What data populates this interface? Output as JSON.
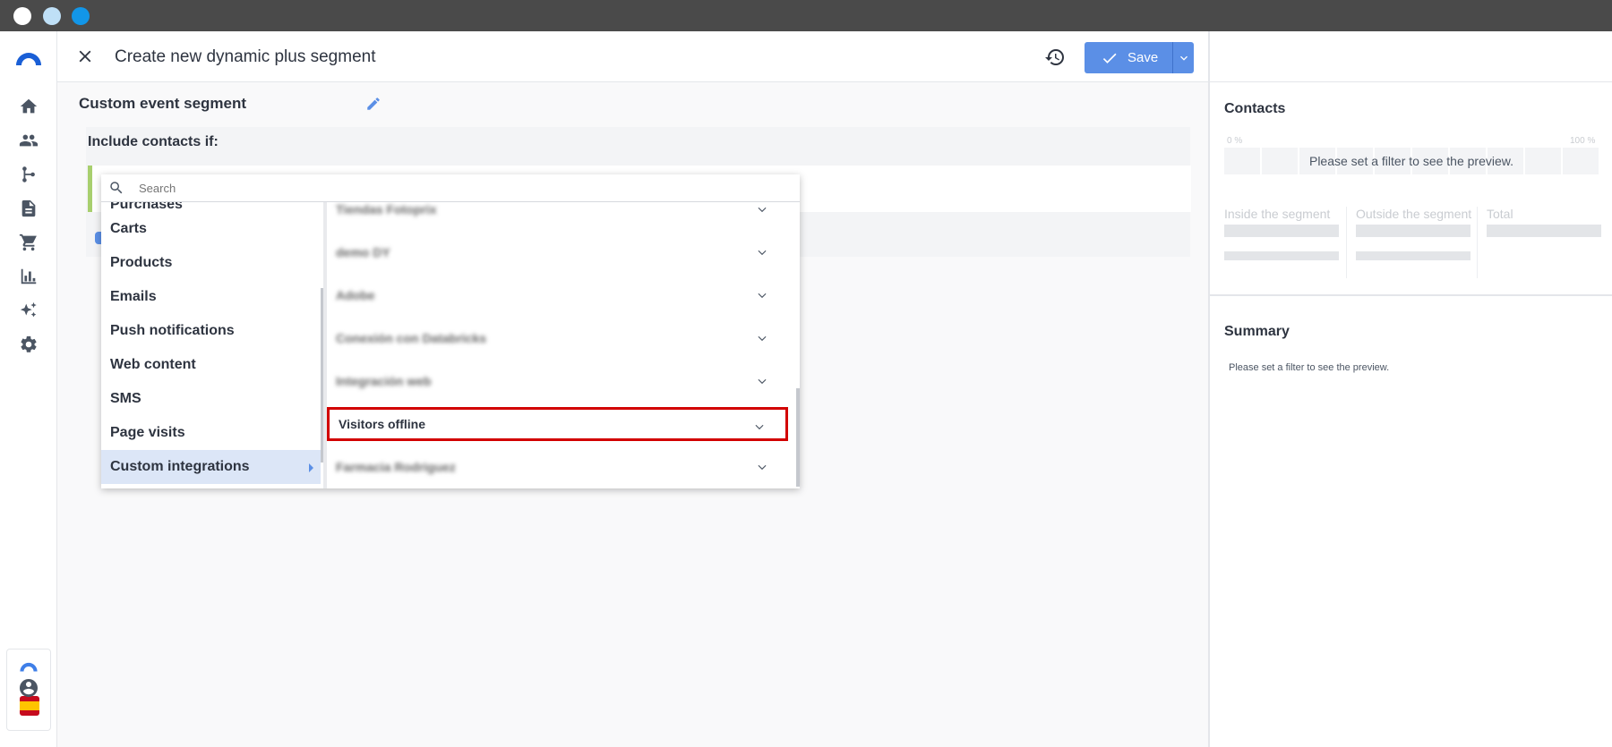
{
  "header": {
    "title": "Create new dynamic plus segment",
    "save_label": "Save"
  },
  "segment": {
    "name": "Custom event segment",
    "include_label": "Include contacts if:"
  },
  "dropdown": {
    "search_placeholder": "Search",
    "categories": [
      {
        "label": "Purchases",
        "active": false
      },
      {
        "label": "Carts",
        "active": false
      },
      {
        "label": "Products",
        "active": false
      },
      {
        "label": "Emails",
        "active": false
      },
      {
        "label": "Push notifications",
        "active": false
      },
      {
        "label": "Web content",
        "active": false
      },
      {
        "label": "SMS",
        "active": false
      },
      {
        "label": "Page visits",
        "active": false
      },
      {
        "label": "Custom integrations",
        "active": true
      }
    ],
    "integrations": [
      {
        "label": "Tiendas Fotoprix",
        "blurred": true,
        "highlighted": false
      },
      {
        "label": "demo DY",
        "blurred": true,
        "highlighted": false
      },
      {
        "label": "Adobe",
        "blurred": true,
        "highlighted": false
      },
      {
        "label": "Conexión con Databricks",
        "blurred": true,
        "highlighted": false
      },
      {
        "label": "Integración web",
        "blurred": true,
        "highlighted": false
      },
      {
        "label": "Visitors offline",
        "blurred": false,
        "highlighted": true
      },
      {
        "label": "Farmacia Rodriguez",
        "blurred": true,
        "highlighted": false
      }
    ]
  },
  "preview": {
    "contacts_title": "Contacts",
    "pct_min": "0 %",
    "pct_max": "100 %",
    "empty_message": "Please set a filter to see the preview.",
    "stats": [
      {
        "label": "Inside the segment"
      },
      {
        "label": "Outside the segment"
      },
      {
        "label": "Total"
      }
    ],
    "summary_title": "Summary",
    "summary_message": "Please set a filter to see the preview."
  },
  "colors": {
    "accent": "#5b8fe6",
    "highlight_border": "#d20000",
    "filter_bar": "#a8cf6e",
    "active_item_bg": "#dce6f7"
  },
  "icons": {
    "sidebar": [
      "home-icon",
      "contacts-icon",
      "automation-icon",
      "content-icon",
      "cart-icon",
      "analytics-icon",
      "ai-sparkle-icon",
      "settings-icon"
    ]
  }
}
